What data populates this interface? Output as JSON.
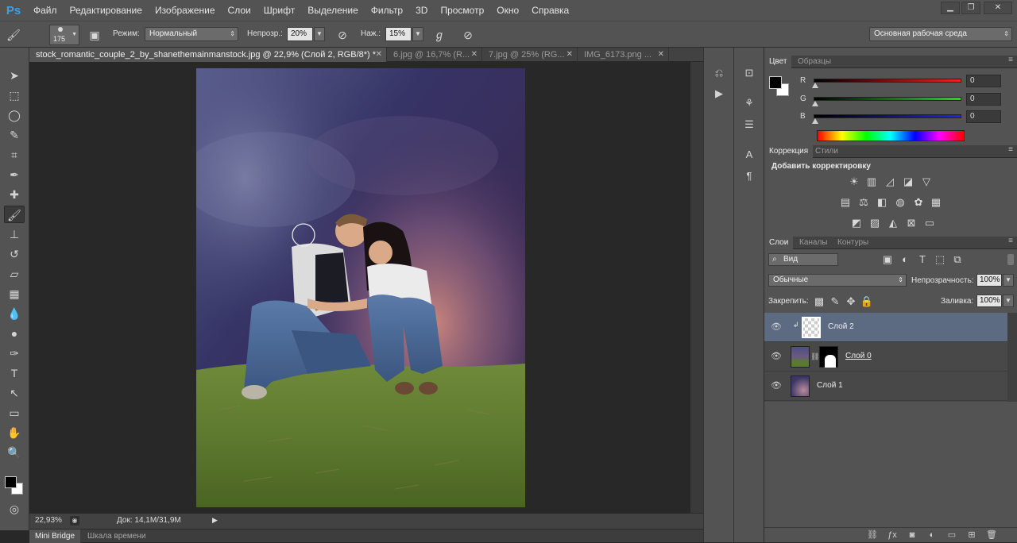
{
  "menu": [
    "Файл",
    "Редактирование",
    "Изображение",
    "Слои",
    "Шрифт",
    "Выделение",
    "Фильтр",
    "3D",
    "Просмотр",
    "Окно",
    "Справка"
  ],
  "app_logo": "Ps",
  "options": {
    "brush_size": "175",
    "mode_label": "Режим:",
    "mode_value": "Нормальный",
    "opacity_label": "Непрозр.:",
    "opacity_value": "20%",
    "flow_label": "Наж.:",
    "flow_value": "15%",
    "workspace_value": "Основная рабочая среда"
  },
  "tabs": [
    {
      "label": "stock_romantic_couple_2_by_shanethemainmanstock.jpg @ 22,9% (Слой 2, RGB/8*) *"
    },
    {
      "label": "6.jpg @ 16,7% (R..."
    },
    {
      "label": "7.jpg @ 25% (RG..."
    },
    {
      "label": "IMG_6173.png ..."
    }
  ],
  "status": {
    "zoom": "22,93%",
    "doc_info": "Док: 14,1M/31,9M"
  },
  "bottom_tabs": [
    "Mini Bridge",
    "Шкала времени"
  ],
  "color_panel": {
    "tabs": [
      "Цвет",
      "Образцы"
    ],
    "r_label": "R",
    "r_value": "0",
    "g_label": "G",
    "g_value": "0",
    "b_label": "B",
    "b_value": "0"
  },
  "adjustments_panel": {
    "tabs": [
      "Коррекция",
      "Стили"
    ],
    "title": "Добавить корректировку"
  },
  "layers_panel": {
    "tabs": [
      "Слои",
      "Каналы",
      "Контуры"
    ],
    "filter_value": "Вид",
    "blend_value": "Обычные",
    "opacity_label": "Непрозрачность:",
    "opacity_value": "100%",
    "lock_label": "Закрепить:",
    "fill_label": "Заливка:",
    "fill_value": "100%",
    "layers": [
      {
        "name": "Слой 2"
      },
      {
        "name": "Слой 0"
      },
      {
        "name": "Слой 1"
      }
    ]
  },
  "colors": {
    "accent": "#38a1e8",
    "selected_layer": "#5c6a82"
  }
}
